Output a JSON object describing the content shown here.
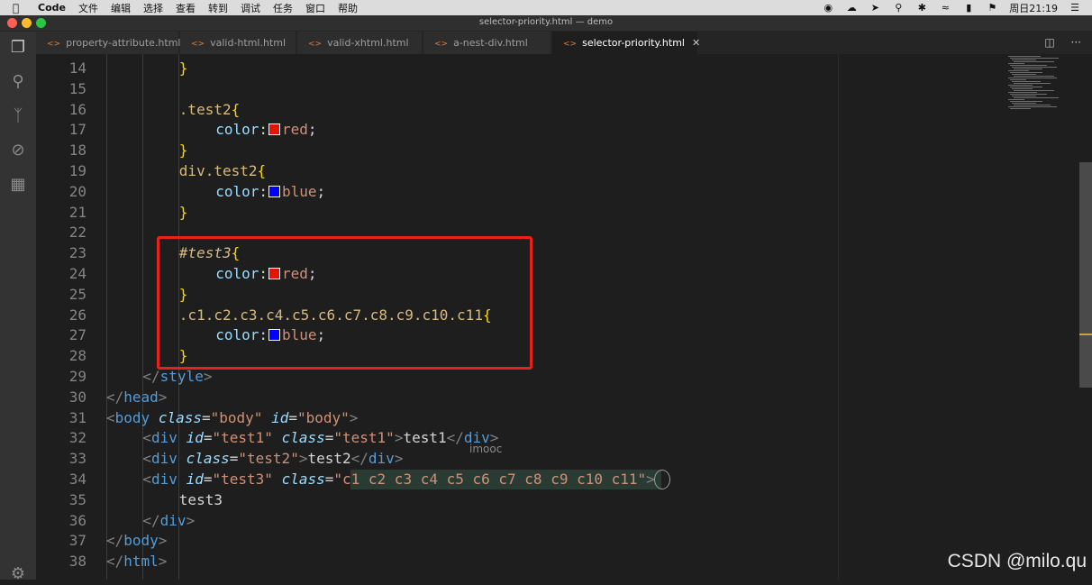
{
  "menubar": {
    "items": [
      "Code",
      "文件",
      "编辑",
      "选择",
      "查看",
      "转到",
      "调试",
      "任务",
      "窗口",
      "帮助"
    ],
    "clock": "周日21:19"
  },
  "window": {
    "title": "selector-priority.html — demo"
  },
  "tabs": [
    {
      "label": "property-attribute.html",
      "active": false
    },
    {
      "label": "valid-html.html",
      "active": false
    },
    {
      "label": "valid-xhtml.html",
      "active": false
    },
    {
      "label": "a-nest-div.html",
      "active": false
    },
    {
      "label": "selector-priority.html",
      "active": true
    }
  ],
  "editor": {
    "lines": [
      {
        "n": "14",
        "indent": 4,
        "tokens": [
          {
            "t": "}",
            "k": "brace"
          }
        ]
      },
      {
        "n": "15",
        "indent": 0,
        "tokens": []
      },
      {
        "n": "16",
        "indent": 4,
        "tokens": [
          {
            "t": ".test2",
            "k": "sel"
          },
          {
            "t": "{",
            "k": "brace"
          }
        ]
      },
      {
        "n": "17",
        "indent": 6,
        "tokens": [
          {
            "t": "color",
            "k": "prop"
          },
          {
            "t": ":",
            "k": "punc"
          },
          {
            "sw": "#e51400"
          },
          {
            "t": "red",
            "k": "val"
          },
          {
            "t": ";",
            "k": "punc"
          }
        ]
      },
      {
        "n": "18",
        "indent": 4,
        "tokens": [
          {
            "t": "}",
            "k": "brace"
          }
        ]
      },
      {
        "n": "19",
        "indent": 4,
        "tokens": [
          {
            "t": "div",
            "k": "sel"
          },
          {
            "t": ".test2",
            "k": "sel"
          },
          {
            "t": "{",
            "k": "brace"
          }
        ]
      },
      {
        "n": "20",
        "indent": 6,
        "tokens": [
          {
            "t": "color",
            "k": "prop"
          },
          {
            "t": ":",
            "k": "punc"
          },
          {
            "sw": "#0000ff"
          },
          {
            "t": "blue",
            "k": "val"
          },
          {
            "t": ";",
            "k": "punc"
          }
        ]
      },
      {
        "n": "21",
        "indent": 4,
        "tokens": [
          {
            "t": "}",
            "k": "brace"
          }
        ]
      },
      {
        "n": "22",
        "indent": 0,
        "tokens": []
      },
      {
        "n": "23",
        "indent": 4,
        "tokens": [
          {
            "t": "#test3",
            "k": "id"
          },
          {
            "t": "{",
            "k": "brace"
          }
        ]
      },
      {
        "n": "24",
        "indent": 6,
        "tokens": [
          {
            "t": "color",
            "k": "prop"
          },
          {
            "t": ":",
            "k": "punc"
          },
          {
            "sw": "#e51400"
          },
          {
            "t": "red",
            "k": "val"
          },
          {
            "t": ";",
            "k": "punc"
          }
        ]
      },
      {
        "n": "25",
        "indent": 4,
        "tokens": [
          {
            "t": "}",
            "k": "brace"
          }
        ]
      },
      {
        "n": "26",
        "indent": 4,
        "tokens": [
          {
            "t": ".c1.c2.c3.c4.c5.c6.c7.c8.c9.c10.c11",
            "k": "sel"
          },
          {
            "t": "{",
            "k": "brace"
          }
        ]
      },
      {
        "n": "27",
        "indent": 6,
        "tokens": [
          {
            "t": "color",
            "k": "prop"
          },
          {
            "t": ":",
            "k": "punc"
          },
          {
            "sw": "#0000ff"
          },
          {
            "t": "blue",
            "k": "val"
          },
          {
            "t": ";",
            "k": "punc"
          }
        ]
      },
      {
        "n": "28",
        "indent": 4,
        "tokens": [
          {
            "t": "}",
            "k": "brace"
          }
        ]
      },
      {
        "n": "29",
        "indent": 2,
        "tokens": [
          {
            "t": "</",
            "k": "tagb"
          },
          {
            "t": "style",
            "k": "tag"
          },
          {
            "t": ">",
            "k": "tagb"
          }
        ]
      },
      {
        "n": "30",
        "indent": 0,
        "tokens": [
          {
            "t": "</",
            "k": "tagb"
          },
          {
            "t": "head",
            "k": "tag"
          },
          {
            "t": ">",
            "k": "tagb"
          }
        ]
      },
      {
        "n": "31",
        "indent": 0,
        "tokens": [
          {
            "t": "<",
            "k": "tagb"
          },
          {
            "t": "body",
            "k": "tag"
          },
          {
            "t": " ",
            "k": "text"
          },
          {
            "t": "class",
            "k": "attr"
          },
          {
            "t": "=",
            "k": "punc"
          },
          {
            "t": "\"body\"",
            "k": "str"
          },
          {
            "t": " ",
            "k": "text"
          },
          {
            "t": "id",
            "k": "attr"
          },
          {
            "t": "=",
            "k": "punc"
          },
          {
            "t": "\"body\"",
            "k": "str"
          },
          {
            "t": ">",
            "k": "tagb"
          }
        ]
      },
      {
        "n": "32",
        "indent": 2,
        "tokens": [
          {
            "t": "<",
            "k": "tagb"
          },
          {
            "t": "div",
            "k": "tag"
          },
          {
            "t": " ",
            "k": "text"
          },
          {
            "t": "id",
            "k": "attr"
          },
          {
            "t": "=",
            "k": "punc"
          },
          {
            "t": "\"test1\"",
            "k": "str"
          },
          {
            "t": " ",
            "k": "text"
          },
          {
            "t": "class",
            "k": "attr"
          },
          {
            "t": "=",
            "k": "punc"
          },
          {
            "t": "\"test1\"",
            "k": "str"
          },
          {
            "t": ">",
            "k": "tagb"
          },
          {
            "t": "test1",
            "k": "text"
          },
          {
            "t": "</",
            "k": "tagb"
          },
          {
            "t": "div",
            "k": "tag"
          },
          {
            "t": ">",
            "k": "tagb"
          }
        ]
      },
      {
        "n": "33",
        "indent": 2,
        "tokens": [
          {
            "t": "<",
            "k": "tagb"
          },
          {
            "t": "div",
            "k": "tag"
          },
          {
            "t": " ",
            "k": "text"
          },
          {
            "t": "class",
            "k": "attr"
          },
          {
            "t": "=",
            "k": "punc"
          },
          {
            "t": "\"test2\"",
            "k": "str"
          },
          {
            "t": ">",
            "k": "tagb"
          },
          {
            "t": "test2",
            "k": "text"
          },
          {
            "t": "</",
            "k": "tagb"
          },
          {
            "t": "div",
            "k": "tag"
          },
          {
            "t": ">",
            "k": "tagb"
          }
        ]
      },
      {
        "n": "34",
        "indent": 2,
        "tokens": [
          {
            "t": "<",
            "k": "tagb"
          },
          {
            "t": "div",
            "k": "tag"
          },
          {
            "t": " ",
            "k": "text"
          },
          {
            "t": "id",
            "k": "attr"
          },
          {
            "t": "=",
            "k": "punc"
          },
          {
            "t": "\"test3\"",
            "k": "str"
          },
          {
            "t": " ",
            "k": "text"
          },
          {
            "t": "class",
            "k": "attr"
          },
          {
            "t": "=",
            "k": "punc"
          },
          {
            "t": "\"c1 c2 c3 c4 c5 c6 c7 c8 c9 c10 c11\"",
            "k": "str"
          },
          {
            "t": ">",
            "k": "tagb"
          }
        ]
      },
      {
        "n": "35",
        "indent": 4,
        "tokens": [
          {
            "t": "test3",
            "k": "text"
          }
        ]
      },
      {
        "n": "36",
        "indent": 2,
        "tokens": [
          {
            "t": "</",
            "k": "tagb"
          },
          {
            "t": "div",
            "k": "tag"
          },
          {
            "t": ">",
            "k": "tagb"
          }
        ]
      },
      {
        "n": "37",
        "indent": 0,
        "tokens": [
          {
            "t": "</",
            "k": "tagb"
          },
          {
            "t": "body",
            "k": "tag"
          },
          {
            "t": ">",
            "k": "tagb"
          }
        ]
      },
      {
        "n": "38",
        "indent": 0,
        "tokens": [
          {
            "t": "</",
            "k": "tagb"
          },
          {
            "t": "html",
            "k": "tag"
          },
          {
            "t": ">",
            "k": "tagb"
          }
        ]
      }
    ]
  },
  "watermarks": {
    "imooc": "imooc",
    "csdn": "CSDN @milo.qu"
  },
  "colors": {
    "highlight_border": "#e6221a",
    "editor_bg": "#1e1e1e"
  }
}
